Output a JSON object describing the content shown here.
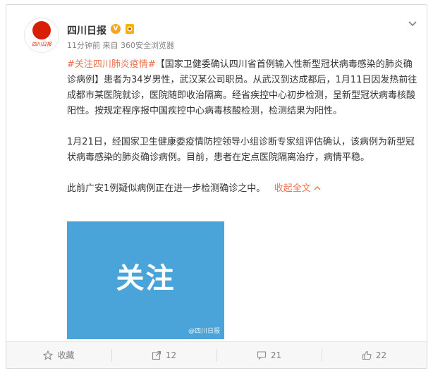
{
  "post": {
    "author": {
      "name": "四川日报",
      "avatar_caption": "四川日报",
      "verified_badge": "V"
    },
    "meta": {
      "time": "11分钟前",
      "source_prefix": "来自",
      "source": "360安全浏览器"
    },
    "paragraphs": {
      "p1": {
        "hashtag": "#关注四川肺炎疫情#",
        "text": "【国家卫健委确认四川省首例输入性新型冠状病毒感染的肺炎确诊病例】患者为34岁男性，武汉某公司职员。从武汉到达成都后，1月11日因发热前往成都市某医院就诊，医院随即收治隔离。经省疾控中心初步检测，呈新型冠状病毒核酸阳性。按规定程序报中国疾控中心病毒核酸检测，检测结果为阳性。"
      },
      "p2": {
        "text": "1月21日，经国家卫生健康委疫情防控领导小组诊断专家组评估确认，该病例为新型冠状病毒感染的肺炎确诊病例。目前，患者在定点医院隔离治疗，病情平稳。"
      },
      "p3": {
        "text": "此前广安1例疑似病例正在进一步检测确诊之中。",
        "collapse": "收起全文"
      }
    },
    "media": {
      "text": "关注",
      "watermark": "@四川日报"
    },
    "actions": {
      "favorite": "收藏",
      "share": "12",
      "comment": "21",
      "like": "22"
    }
  },
  "colors": {
    "link": "#eb7350",
    "media_bg": "#4aa3d9",
    "brand_red": "#d81e06"
  },
  "icons": {
    "favorite": "star-outline-icon",
    "share": "share-icon",
    "comment": "comment-icon",
    "like": "thumb-up-icon",
    "menu": "chevron-down-icon"
  }
}
